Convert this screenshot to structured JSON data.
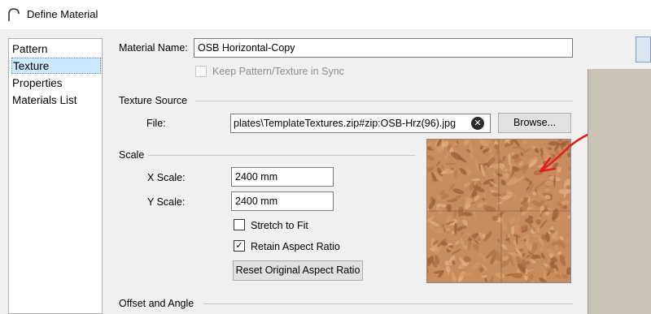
{
  "window": {
    "title": "Define Material"
  },
  "nav": {
    "items": [
      {
        "label": "Pattern"
      },
      {
        "label": "Texture"
      },
      {
        "label": "Properties"
      },
      {
        "label": "Materials List"
      }
    ],
    "selected": "Texture"
  },
  "material_name": {
    "label": "Material Name:",
    "value": "OSB Horizontal-Copy"
  },
  "keep_sync": {
    "label": "Keep Pattern/Texture in Sync",
    "checked": false,
    "enabled": false
  },
  "texture_source": {
    "header": "Texture Source",
    "file_label": "File:",
    "file_value": "plates\\TemplateTextures.zip#zip:OSB-Hrz(96).jpg",
    "browse_label": "Browse..."
  },
  "scale": {
    "header": "Scale",
    "x_label": "X Scale:",
    "x_value": "2400 mm",
    "y_label": "Y Scale:",
    "y_value": "2400 mm",
    "stretch_label": "Stretch to Fit",
    "stretch_checked": false,
    "retain_label": "Retain Aspect Ratio",
    "retain_checked": true,
    "reset_label": "Reset Original Aspect Ratio"
  },
  "offset": {
    "header": "Offset and Angle"
  },
  "icons": {
    "app": "arch-icon",
    "clear": "clear-icon",
    "check": "checkmark-icon",
    "annotation": "red-arrow-annotation"
  },
  "colors": {
    "selection": "#cce8ff",
    "texture_base": "#c78c5e",
    "annotation": "#e02020",
    "right_panel": "#c9c2b5"
  }
}
